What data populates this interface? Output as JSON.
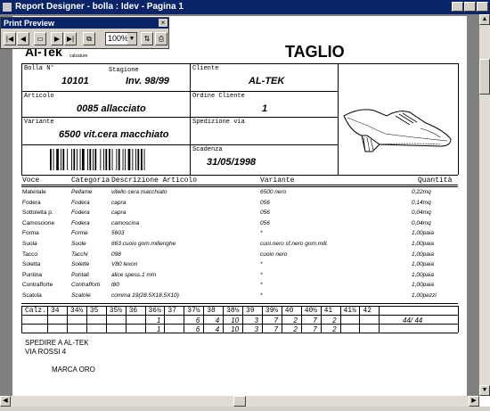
{
  "window": {
    "title": "Report Designer - bolla : Idev - Pagina 1"
  },
  "preview_toolbar": {
    "title": "Print Preview",
    "zoom": "100%"
  },
  "report": {
    "brand": "Al-Tek",
    "brand_sub": "calzature",
    "doc_title": "TAGLIO",
    "fields": {
      "bolla_label": "Bolla N°",
      "bolla_value": "10101",
      "stagione_label": "Stagione",
      "stagione_value": "Inv. 98/99",
      "cliente_label": "Cliente",
      "cliente_value": "AL-TEK",
      "articolo_label": "Articolo",
      "articolo_value": "0085 allacciato",
      "ordine_label": "Ordine Cliente",
      "ordine_value": "1",
      "variante_label": "Variante",
      "variante_value": "6500 vit.cera macchiato",
      "spedizione_label": "Spedizione via",
      "spedizione_value": "",
      "scadenza_label": "Scadenza",
      "scadenza_value": "31/05/1998"
    },
    "table": {
      "headers": {
        "voce": "Voce",
        "categoria": "Categoria",
        "descrizione": "Descrizione Articolo",
        "variante": "Variante",
        "quantita": "Quantità"
      },
      "rows": [
        {
          "voce": "Materiale",
          "categoria": "Pellame",
          "descrizione": "vitello cera macchiato",
          "variante": "6500 nero",
          "quantita": "0,22mq"
        },
        {
          "voce": "Fodera",
          "categoria": "Fodera",
          "descrizione": "capra",
          "variante": "056",
          "quantita": "0,14mq"
        },
        {
          "voce": "Sottoletta p.",
          "categoria": "Fodera",
          "descrizione": "capra",
          "variante": "056",
          "quantita": "0,04mq"
        },
        {
          "voce": "Camoscione",
          "categoria": "Fodera",
          "descrizione": "camoscina",
          "variante": "056",
          "quantita": "0,04mq"
        },
        {
          "voce": "Forma",
          "categoria": "Forme",
          "descrizione": "5603",
          "variante": "*",
          "quantita": "1,00paia"
        },
        {
          "voce": "Suola",
          "categoria": "Suole",
          "descrizione": "663 cuoio gom.millerighe",
          "variante": "cuoi.nero sf.nero gom.mill.",
          "quantita": "1,00paia"
        },
        {
          "voce": "Tacco",
          "categoria": "Tacchi",
          "descrizione": "098",
          "variante": "cuoio nero",
          "quantita": "1,00paia"
        },
        {
          "voce": "Soletta",
          "categoria": "Solette",
          "descrizione": "V80 texon",
          "variante": "*",
          "quantita": "1,00paia"
        },
        {
          "voce": "Puntina",
          "categoria": "Puntali",
          "descrizione": "alice spess.1 mm",
          "variante": "*",
          "quantita": "1,00paia"
        },
        {
          "voce": "Contrafforte",
          "categoria": "Contrafforti",
          "descrizione": "t80",
          "variante": "*",
          "quantita": "1,00paia"
        },
        {
          "voce": "Scatola",
          "categoria": "Scatole",
          "descrizione": "comma 19(28.5X18.5X10)",
          "variante": "*",
          "quantita": "1,00pezzi"
        }
      ]
    },
    "sizes": {
      "label": "Calz.",
      "headers": [
        "34",
        "34½",
        "35",
        "35½",
        "36",
        "36½",
        "37",
        "37½",
        "38",
        "38½",
        "39",
        "39½",
        "40",
        "40½",
        "41",
        "41½",
        "42"
      ],
      "row1": [
        "",
        "",
        "",
        "",
        "",
        "1",
        "",
        "6",
        "4",
        "10",
        "3",
        "7",
        "2",
        "7",
        "2",
        "",
        ""
      ],
      "row2": [
        "",
        "",
        "",
        "",
        "",
        "1",
        "",
        "6",
        "4",
        "10",
        "3",
        "7",
        "2",
        "7",
        "2",
        "",
        ""
      ],
      "total": "44/   44"
    },
    "footer": {
      "line1": "SPEDIRE A AL-TEK",
      "line2": "VIA ROSSI 4",
      "line3": "MARCA  ORO"
    }
  }
}
